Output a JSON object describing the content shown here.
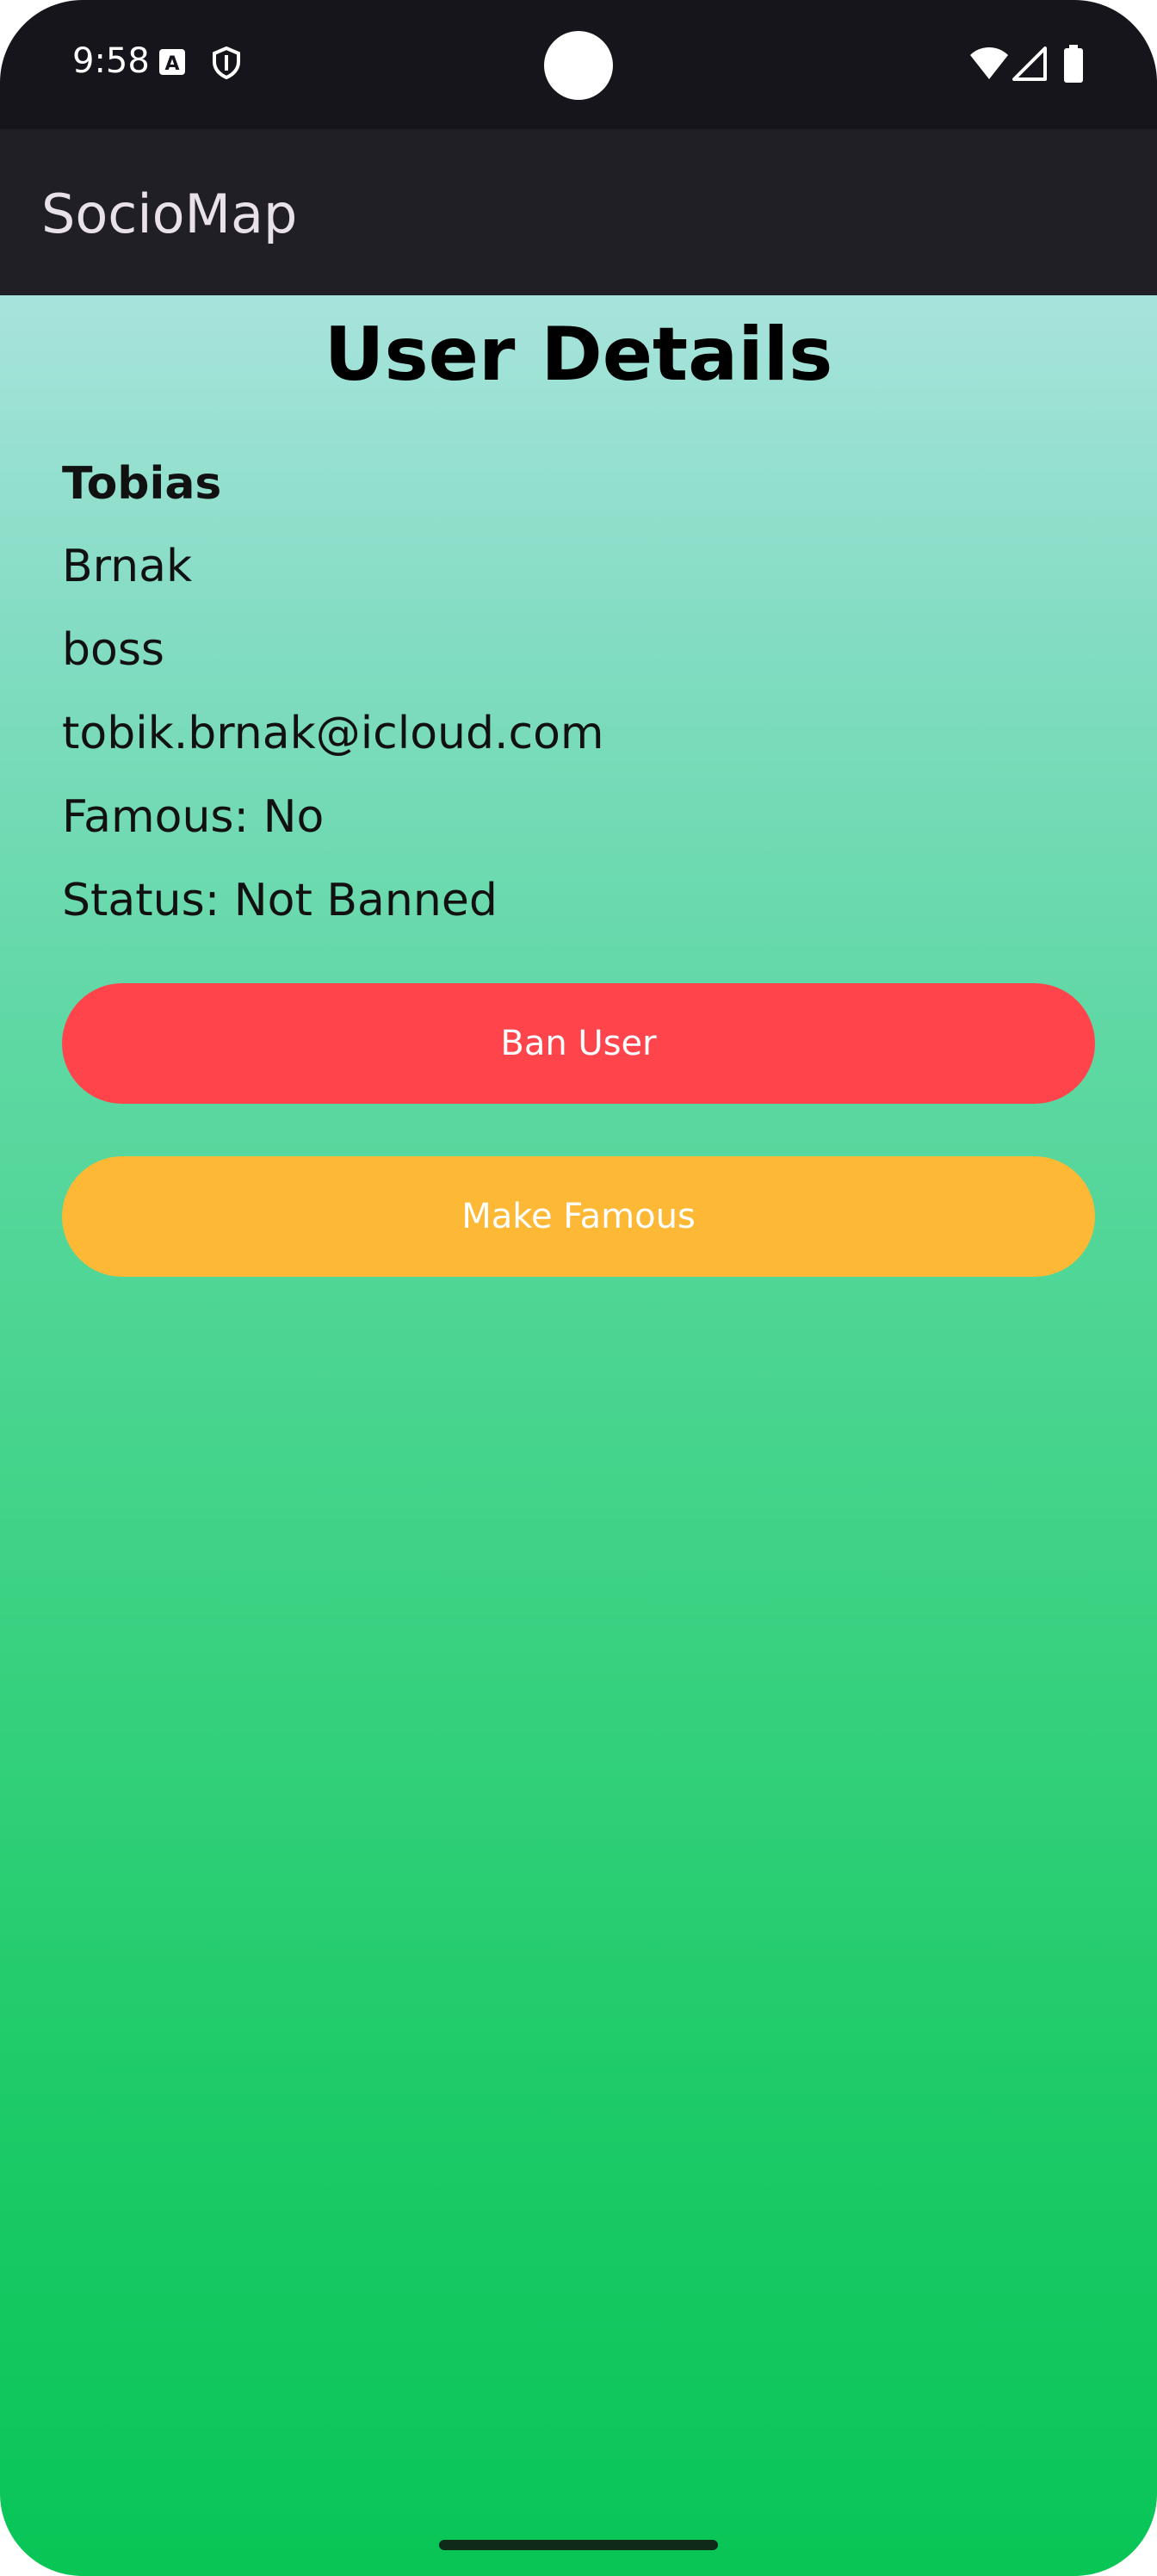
{
  "status_bar": {
    "time": "9:58",
    "icons": [
      "a-notification-icon",
      "shield-icon",
      "wifi-icon",
      "cell-signal-icon",
      "battery-icon"
    ]
  },
  "app_bar": {
    "title": "SocioMap"
  },
  "page": {
    "title": "User Details"
  },
  "user": {
    "first_name": "Tobias",
    "last_name": "Brnak",
    "username": "boss",
    "email": "tobik.brnak@icloud.com",
    "famous": "Famous: No",
    "status": "Status: Not Banned"
  },
  "actions": {
    "ban_label": "Ban User",
    "famous_label": "Make Famous"
  },
  "colors": {
    "ban_button": "#ff454b",
    "famous_button": "#fdb835",
    "status_bar": "#16151b",
    "app_bar": "#211f26"
  }
}
